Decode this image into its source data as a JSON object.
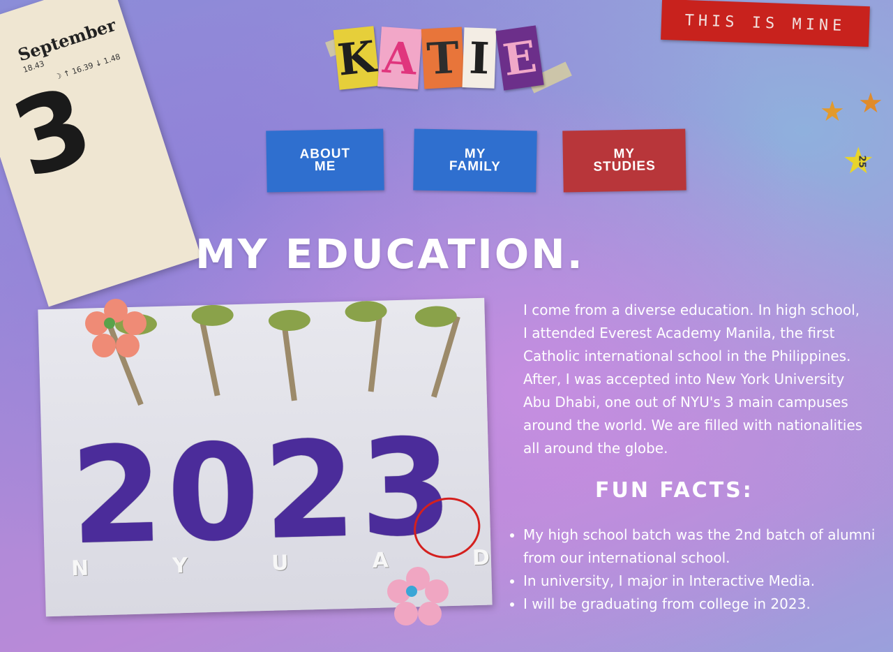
{
  "calendar": {
    "month": "September",
    "time": "18.43",
    "info": "☽ ↑ 16.39 ↓ 1.48",
    "day": "3"
  },
  "tag": {
    "label": "THIS IS MINE"
  },
  "logo": {
    "letters": [
      "K",
      "A",
      "T",
      "I",
      "E"
    ]
  },
  "stars": {
    "badge": "25"
  },
  "nav": [
    {
      "label": "ABOUT\nME",
      "color": "#2f6fcf"
    },
    {
      "label": "MY\nFAMILY",
      "color": "#2f6fcf"
    },
    {
      "label": "MY\nSTUDIES",
      "color": "#b8363a"
    }
  ],
  "heading": "MY EDUCATION.",
  "photo": {
    "year": "2023",
    "letters": [
      "N",
      "Y",
      "U",
      "A",
      "D"
    ]
  },
  "intro": "I come from a diverse education. In high school, I attended Everest Academy Manila, the first Catholic international school in the Philippines. After, I was accepted into New York University Abu Dhabi, one out of NYU's 3 main campuses around the world. We are filled with nationalities all around the globe.",
  "fun_facts": {
    "title": "FUN FACTS:",
    "items": [
      "My high school batch was the 2nd batch of alumni from our international school.",
      "In university, I major in Interactive Media.",
      "I will be graduating from college in 2023."
    ]
  },
  "colors": {
    "accent_red": "#c8221d",
    "nav_blue": "#2f6fcf",
    "nav_red": "#b8363a",
    "text": "#ffffff"
  }
}
